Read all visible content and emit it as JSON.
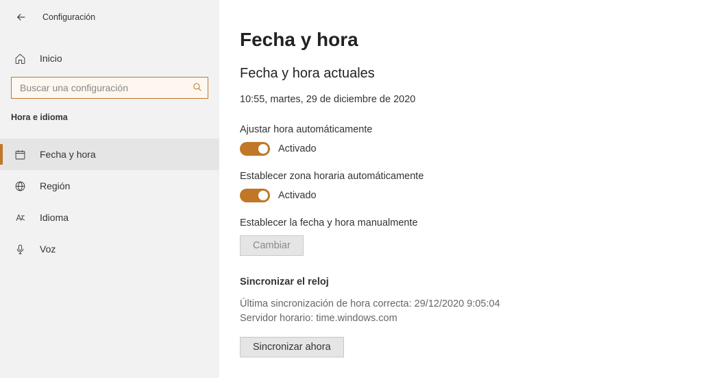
{
  "header": {
    "title": "Configuración"
  },
  "sidebar": {
    "home_label": "Inicio",
    "search_placeholder": "Buscar una configuración",
    "category": "Hora e idioma",
    "items": [
      {
        "label": "Fecha y hora",
        "icon": "datetime-icon",
        "active": true
      },
      {
        "label": "Región",
        "icon": "globe-icon",
        "active": false
      },
      {
        "label": "Idioma",
        "icon": "language-icon",
        "active": false
      },
      {
        "label": "Voz",
        "icon": "mic-icon",
        "active": false
      }
    ]
  },
  "main": {
    "page_title": "Fecha y hora",
    "section_title": "Fecha y hora actuales",
    "current_datetime": "10:55, martes, 29 de diciembre de 2020",
    "auto_time": {
      "label": "Ajustar hora automáticamente",
      "state": "Activado",
      "on": true
    },
    "auto_tz": {
      "label": "Establecer zona horaria automáticamente",
      "state": "Activado",
      "on": true
    },
    "manual": {
      "label": "Establecer la fecha y hora manualmente",
      "button": "Cambiar",
      "disabled": true
    },
    "sync": {
      "title": "Sincronizar el reloj",
      "last_sync": "Última sincronización de hora correcta: 29/12/2020 9:05:04",
      "server": "Servidor horario: time.windows.com",
      "button": "Sincronizar ahora"
    }
  }
}
